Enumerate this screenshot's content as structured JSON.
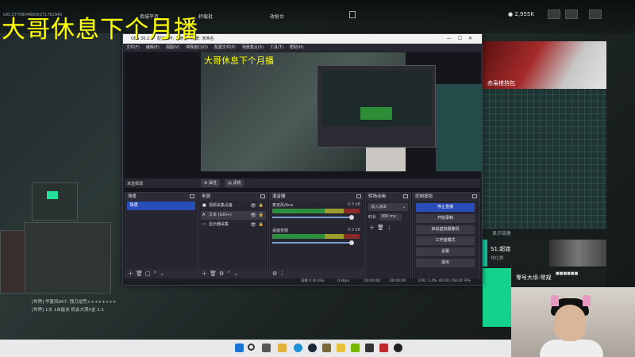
{
  "stream_overlay": {
    "title": "大哥休息下个月播"
  },
  "game": {
    "uid": "UID:27708049000371781945",
    "tabs": [
      "商城平页",
      "转载批",
      "改枪台"
    ],
    "currency": "2,955K",
    "panel1_label": "赤枭搭挡包",
    "panel2_label": "显示装备",
    "card1_title": "S1:超渡",
    "card1_sub": "排位赛",
    "card2_title": "零号大坝-常规",
    "card2_badge": "■■■■■■",
    "chat_lines": [
      "[世界] 华夏风007: 残刃拾荒++++++++",
      "[世界] 1水 1自能谈 机会大哭5金 2-1"
    ]
  },
  "obs": {
    "title": "OBS 30.2.3 - 配置文件: 未命名 - 场景: 未命名",
    "menu": [
      "文件(F)",
      "编辑(E)",
      "视图(V)",
      "停靠窗口(D)",
      "配置文件(P)",
      "场景集合(S)",
      "工具(T)",
      "帮助(H)"
    ],
    "preview_caption": "大哥休息下个月播",
    "toolbar": {
      "scene_label": "未选择源",
      "settings": "属性",
      "filters": "滤镜"
    },
    "scenes": {
      "header": "场景",
      "items": [
        "场景"
      ]
    },
    "sources": {
      "header": "来源",
      "items": [
        {
          "name": "视频采集设备",
          "icon": "camera-icon"
        },
        {
          "name": "文本 (GDI+)",
          "icon": "text-icon"
        },
        {
          "name": "显示器采集",
          "icon": "monitor-icon"
        }
      ]
    },
    "mixer": {
      "header": "混音器",
      "channels": [
        {
          "name": "麦克风/Aux",
          "db": "0.0 dB"
        },
        {
          "name": "桌面音频",
          "db": "0.0 dB"
        }
      ]
    },
    "transitions": {
      "header": "转场动画",
      "selected": "淡入淡出",
      "duration_label": "时长",
      "duration": "300 ms"
    },
    "controls": {
      "header": "控制按钮",
      "buttons": [
        "停止直播",
        "开始录制",
        "启动虚拟摄像机",
        "工作室模式",
        "设置",
        "退出"
      ]
    },
    "status": {
      "dropped": "丢帧 0 (0.0%)",
      "bitrate": "0 kbps",
      "live": "00:00:00",
      "rec": "00:00:00",
      "cpu": "CPU: 1.4%",
      "fps": "60.00 / 60.00 FPS"
    }
  },
  "taskbar": {
    "apps": [
      "windows-icon",
      "search-icon",
      "task-view-icon",
      "explorer-icon",
      "edge-icon",
      "steam-icon",
      "game1-icon",
      "game2-icon",
      "nvidia-icon",
      "game3-icon",
      "red-icon",
      "obs-icon"
    ]
  }
}
